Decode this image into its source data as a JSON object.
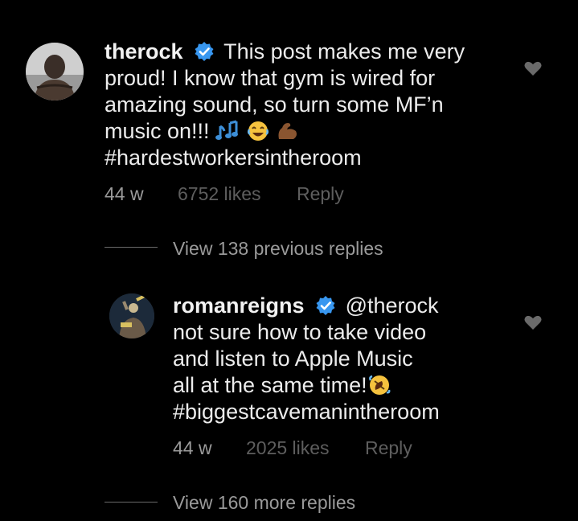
{
  "comments": [
    {
      "username": "therock",
      "verified": true,
      "text_lines": [
        "This post makes me very",
        "proud! I know that gym is wired for",
        "amazing sound, so turn some MF’n",
        "music on!!!"
      ],
      "hashtag": "#hardestworkersintheroom",
      "emojis": [
        "musical-notes-emoji",
        "laughing-emoji",
        "flexed-biceps-emoji"
      ],
      "time": "44 w",
      "likes": "6752 likes",
      "reply_label": "Reply"
    },
    {
      "username": "romanreigns",
      "verified": true,
      "text_lines": [
        "@therock",
        "not sure how to take video",
        "and listen to Apple Music",
        "all at the same time!"
      ],
      "hashtag": "#biggestcavemanintheroom",
      "emojis": [
        "rolling-laughing-emoji"
      ],
      "time": "44 w",
      "likes": "2025 likes",
      "reply_label": "Reply"
    }
  ],
  "view_previous_replies": "View 138 previous replies",
  "view_more_replies": "View 160 more replies",
  "colors": {
    "background": "#000000",
    "text": "#ececec",
    "muted": "#8a8a8a",
    "dim": "#5e5e5e",
    "verified_badge": "#3897f0"
  }
}
